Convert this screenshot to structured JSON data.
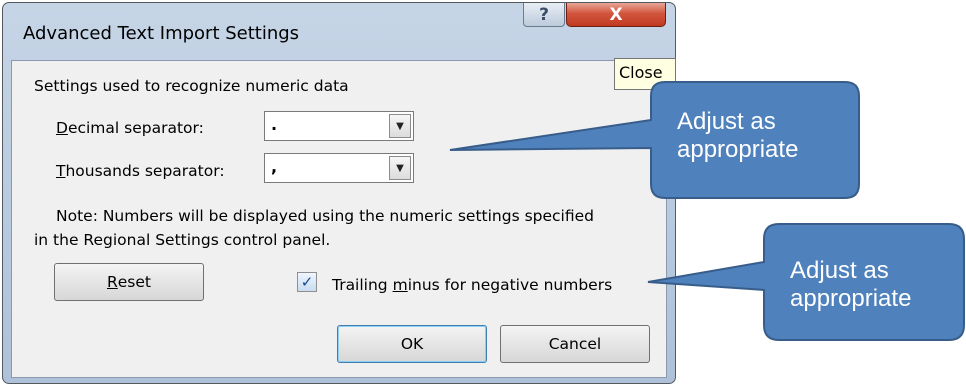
{
  "dialog": {
    "title": "Advanced Text Import Settings",
    "help_label": "?",
    "close_label": "X",
    "close_tooltip": "Close"
  },
  "section": {
    "heading": "Settings used to recognize numeric data"
  },
  "decimal": {
    "label_u": "D",
    "label_rest": "ecimal separator:",
    "value": "."
  },
  "thousands": {
    "label_u": "T",
    "label_rest": "housands separator:",
    "value": ","
  },
  "note": {
    "line1": "Note: Numbers will be displayed using the numeric settings specified",
    "line2": "in the Regional Settings control panel."
  },
  "buttons": {
    "reset_u": "R",
    "reset_rest": "eset",
    "ok": "OK",
    "cancel": "Cancel"
  },
  "trailing": {
    "checked": true,
    "label_pre": "Trailing ",
    "label_u": "m",
    "label_post": "inus for negative numbers"
  },
  "callouts": {
    "top_line1": "Adjust as",
    "top_line2": "appropriate",
    "bottom_line1": "Adjust as",
    "bottom_line2": "appropriate"
  },
  "colors": {
    "callout_fill": "#4f81bd",
    "callout_border": "#385d8a",
    "close_red": "#c0391f",
    "tooltip_bg": "#ffffe1"
  }
}
